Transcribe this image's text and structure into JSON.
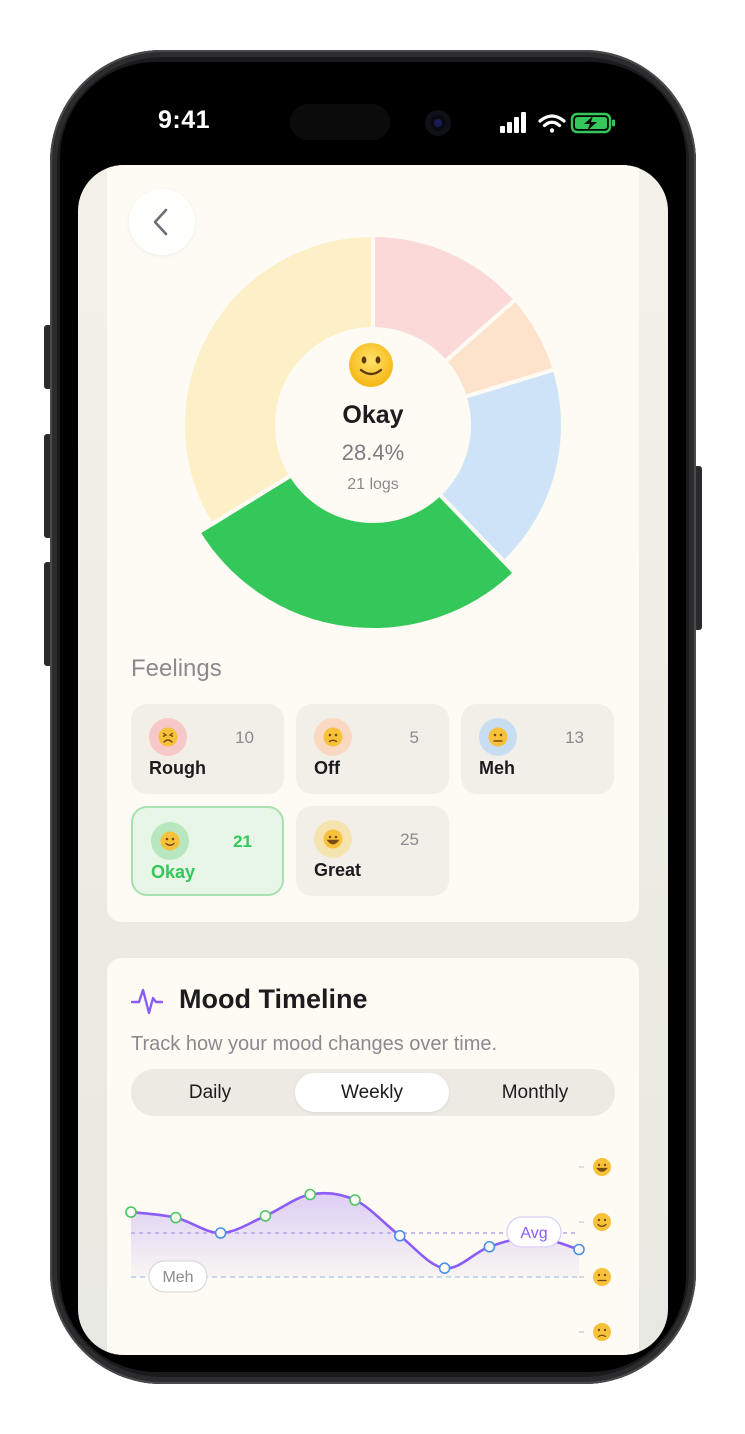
{
  "status_bar": {
    "time": "9:41"
  },
  "distribution": {
    "selected": {
      "label": "Okay",
      "percent": "28.4%",
      "logs": "21 logs"
    },
    "slices": [
      {
        "mood": "Rough",
        "count": 10,
        "color": "#fcd9d9"
      },
      {
        "mood": "Off",
        "count": 5,
        "color": "#fde3cc"
      },
      {
        "mood": "Meh",
        "count": 13,
        "color": "#cfe3f8"
      },
      {
        "mood": "Okay",
        "count": 21,
        "color": "#34c759"
      },
      {
        "mood": "Great",
        "count": 25,
        "color": "#fdf0c6"
      }
    ]
  },
  "feelings": {
    "title": "Feelings",
    "items": [
      {
        "name": "Rough",
        "count": "10",
        "icon_bg": "#f7c8c8",
        "icon": "rough-face-icon"
      },
      {
        "name": "Off",
        "count": "5",
        "icon_bg": "#f9d9c2",
        "icon": "off-face-icon"
      },
      {
        "name": "Meh",
        "count": "13",
        "icon_bg": "#c8dcf2",
        "icon": "meh-face-icon"
      },
      {
        "name": "Okay",
        "count": "21",
        "icon_bg": "#b8e6bf",
        "icon": "okay-face-icon"
      },
      {
        "name": "Great",
        "count": "25",
        "icon_bg": "#f6e4b0",
        "icon": "great-face-icon"
      }
    ],
    "selected": "Okay"
  },
  "timeline": {
    "title": "Mood Timeline",
    "subtitle": "Track how your mood changes over time.",
    "tabs": [
      "Daily",
      "Weekly",
      "Monthly"
    ],
    "active_tab": "Weekly",
    "avg_label": "Avg",
    "ref_label": "Meh",
    "line_color": "#8b5cf6"
  },
  "chart_data": {
    "type": "line",
    "y_levels": [
      "great",
      "okay",
      "meh",
      "off"
    ],
    "ylim": [
      0,
      3
    ],
    "series": [
      {
        "values": [
          2.18,
          2.08,
          1.8,
          2.11,
          2.5,
          2.4,
          1.75,
          1.16,
          1.55,
          1.72,
          1.5
        ]
      }
    ],
    "average": 1.8,
    "reference": 1.0,
    "grid": false
  }
}
